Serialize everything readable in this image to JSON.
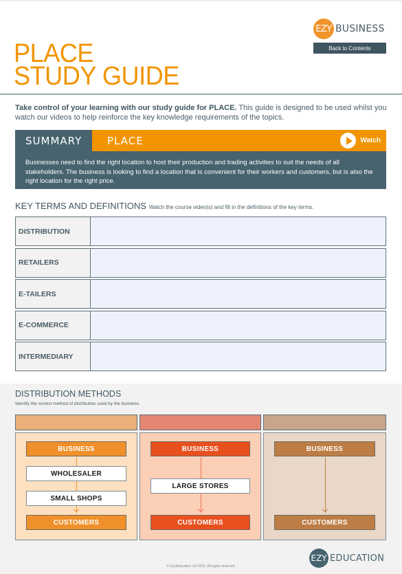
{
  "brand": {
    "badge": "EZY",
    "word": "BUSINESS",
    "back_button": "Back to Contents"
  },
  "title": {
    "line1": "PLACE",
    "line2": "STUDY GUIDE"
  },
  "intro": {
    "bold": "Take control of your learning with our study guide for PLACE.",
    "rest": " This guide is designed to be used whilst you watch our videos to help reinforce the key knowledge requirements of the topics."
  },
  "summary": {
    "tab": "SUMMARY",
    "topic": "PLACE",
    "watch_label": "Watch",
    "body": "Businesses need to find the right location to host their production and trading activities to suit the needs of all stakeholders. The business is looking to find a location that is convenient for their workers and customers, but is also the right location for the right price."
  },
  "key_terms": {
    "title": "KEY TERMS AND DEFINITIONS",
    "subtitle": "Watch the course video(s) and fill in the definitions of the key terms.",
    "rows": [
      {
        "term": "DISTRIBUTION",
        "definition": ""
      },
      {
        "term": "RETAILERS",
        "definition": ""
      },
      {
        "term": "E-TAILERS",
        "definition": ""
      },
      {
        "term": "E-COMMERCE",
        "definition": ""
      },
      {
        "term": "INTERMEDIARY",
        "definition": ""
      }
    ]
  },
  "distribution": {
    "title": "DISTRIBUTION METHODS",
    "subtitle": "Identify the correct method of distribution used by the business.",
    "columns": [
      {
        "header_answer": "",
        "colors": {
          "header": "#ebb07a",
          "panel": "#fde0c0",
          "box": "#f0902a",
          "line": "#f0902a"
        },
        "start": "BUSINESS",
        "intermediaries": [
          "WHOLESALER",
          "SMALL SHOPS"
        ],
        "end": "CUSTOMERS"
      },
      {
        "header_answer": "",
        "colors": {
          "header": "#e38773",
          "panel": "#fbcfb6",
          "box": "#e8501e",
          "line": "#e8755a"
        },
        "start": "BUSINESS",
        "intermediaries": [
          "LARGE STORES"
        ],
        "end": "CUSTOMERS"
      },
      {
        "header_answer": "",
        "colors": {
          "header": "#c9a58c",
          "panel": "#e9d8c8",
          "box": "#bd7d45",
          "line": "#bd7d45"
        },
        "start": "BUSINESS",
        "intermediaries": [],
        "end": "CUSTOMERS"
      }
    ]
  },
  "footer": {
    "copyright": "© EzyEducation Ltd 2021.  All rights reserved.",
    "edu_badge": "EZY",
    "edu_word": "EDUCATION"
  }
}
